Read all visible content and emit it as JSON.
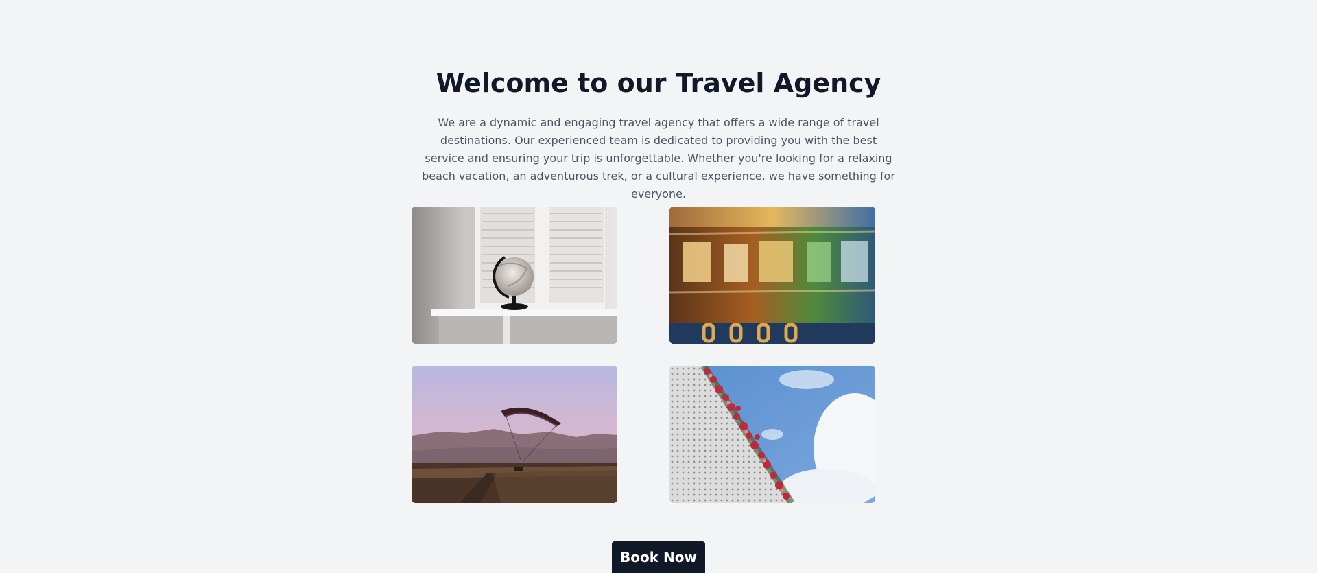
{
  "hero": {
    "title": "Welcome to our Travel Agency",
    "description": "We are a dynamic and engaging travel agency that offers a wide range of travel destinations. Our experienced team is dedicated to providing you with the best service and ensuring your trip is unforgettable. Whether you're looking for a relaxing beach vacation, an adventurous trek, or a cultural experience, we have something for everyone."
  },
  "gallery": [
    {
      "subject": "globe-on-windowsill"
    },
    {
      "subject": "motion-blurred-train"
    },
    {
      "subject": "paraglider-over-mountains"
    },
    {
      "subject": "flowers-against-sky"
    }
  ],
  "cta": {
    "label": "Book Now"
  },
  "colors": {
    "background": "#f3f4f6",
    "heading": "#111827",
    "body_text": "#4b5563",
    "button": "#111827",
    "button_text": "#ffffff"
  }
}
